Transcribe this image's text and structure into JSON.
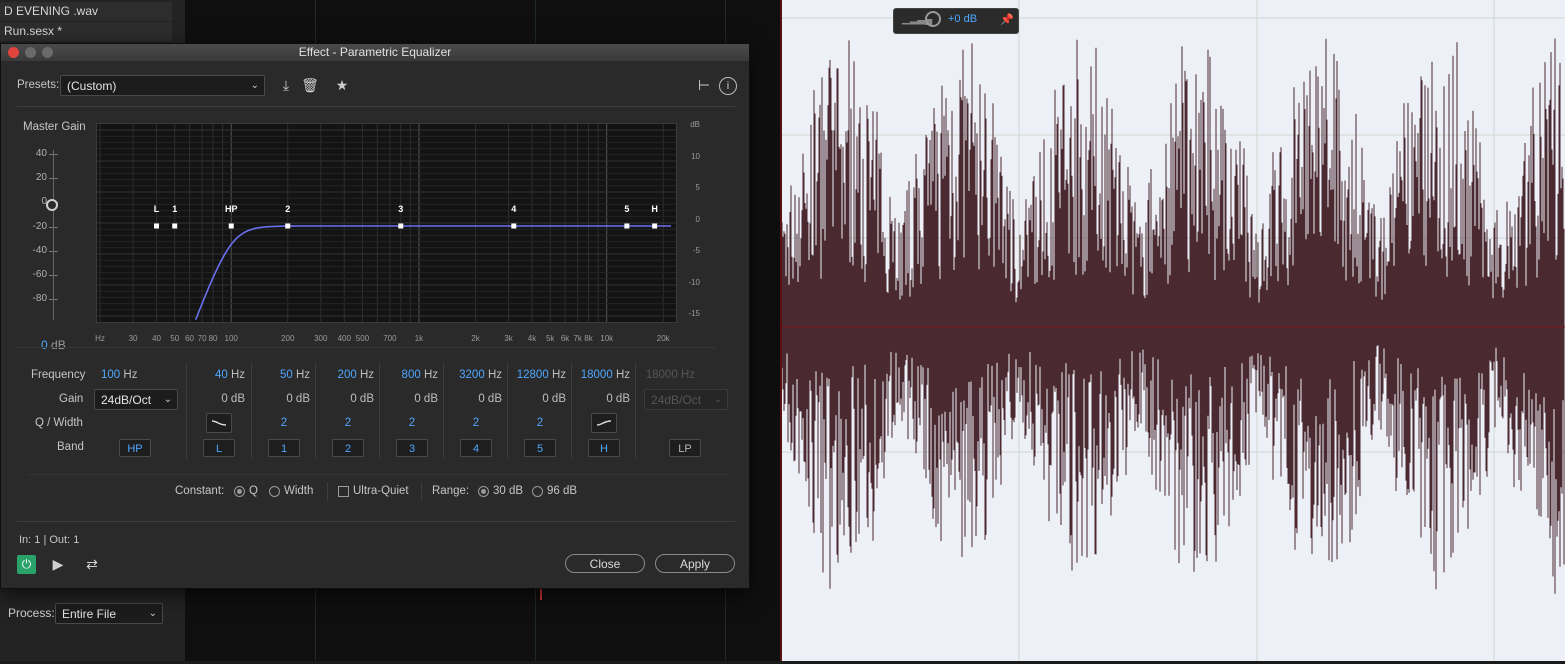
{
  "background": {
    "files": [
      "D EVENING .wav",
      "Run.sesx *"
    ],
    "process_label": "Process:",
    "process_value": "Entire File",
    "hud_gain": "+0 dB"
  },
  "dialog": {
    "title": "Effect - Parametric Equalizer",
    "presets_label": "Presets:",
    "presets_value": "(Custom)",
    "master_gain_label": "Master Gain",
    "master_gain_value": "0",
    "master_gain_unit": "dB",
    "master_gain_ticks": [
      "40",
      "20",
      "0",
      "-20",
      "-40",
      "-60",
      "-80"
    ],
    "graph": {
      "db_ticks": [
        "dB",
        "10",
        "5",
        "0",
        "-5",
        "-10",
        "-15"
      ],
      "freq_ticks": [
        {
          "label": "Hz",
          "f": 20
        },
        {
          "label": "30",
          "f": 30
        },
        {
          "label": "40",
          "f": 40
        },
        {
          "label": "50",
          "f": 50
        },
        {
          "label": "60",
          "f": 60
        },
        {
          "label": "70",
          "f": 70
        },
        {
          "label": "80",
          "f": 80
        },
        {
          "label": "100",
          "f": 100
        },
        {
          "label": "200",
          "f": 200
        },
        {
          "label": "300",
          "f": 300
        },
        {
          "label": "400",
          "f": 400
        },
        {
          "label": "500",
          "f": 500
        },
        {
          "label": "700",
          "f": 700
        },
        {
          "label": "1k",
          "f": 1000
        },
        {
          "label": "2k",
          "f": 2000
        },
        {
          "label": "3k",
          "f": 3000
        },
        {
          "label": "4k",
          "f": 4000
        },
        {
          "label": "5k",
          "f": 5000
        },
        {
          "label": "6k",
          "f": 6000
        },
        {
          "label": "7k",
          "f": 7000
        },
        {
          "label": "8k",
          "f": 8000
        },
        {
          "label": "10k",
          "f": 10000
        },
        {
          "label": "20k",
          "f": 20000
        }
      ],
      "nodes": [
        {
          "label": "L",
          "f": 40
        },
        {
          "label": "1",
          "f": 50
        },
        {
          "label": "HP",
          "f": 100
        },
        {
          "label": "2",
          "f": 200
        },
        {
          "label": "3",
          "f": 800
        },
        {
          "label": "4",
          "f": 3200
        },
        {
          "label": "5",
          "f": 12800
        },
        {
          "label": "H",
          "f": 18000
        }
      ],
      "hp_cutoff_hz": 100,
      "hp_slope_db_oct": 24
    },
    "row_labels": {
      "frequency": "Frequency",
      "gain": "Gain",
      "q": "Q / Width",
      "band": "Band"
    },
    "hz": "Hz",
    "db": "dB",
    "hp_column": {
      "freq": "100",
      "slope": "24dB/Oct",
      "band": "HP"
    },
    "bands": [
      {
        "freq": "40",
        "gain": "0",
        "q": "",
        "band": "L"
      },
      {
        "freq": "50",
        "gain": "0",
        "q": "2",
        "band": "1"
      },
      {
        "freq": "200",
        "gain": "0",
        "q": "2",
        "band": "2"
      },
      {
        "freq": "800",
        "gain": "0",
        "q": "2",
        "band": "3"
      },
      {
        "freq": "3200",
        "gain": "0",
        "q": "2",
        "band": "4"
      },
      {
        "freq": "12800",
        "gain": "0",
        "q": "2",
        "band": "5"
      },
      {
        "freq": "18000",
        "gain": "0",
        "q": "",
        "band": "H"
      }
    ],
    "lp_column": {
      "freq": "18000",
      "slope": "24dB/Oct",
      "band": "LP"
    },
    "constant_label": "Constant:",
    "q_label": "Q",
    "width_label": "Width",
    "ultra_quiet_label": "Ultra-Quiet",
    "range_label": "Range:",
    "range_30": "30 dB",
    "range_96": "96 dB",
    "io_label": "In: 1 | Out: 1",
    "close_label": "Close",
    "apply_label": "Apply"
  }
}
